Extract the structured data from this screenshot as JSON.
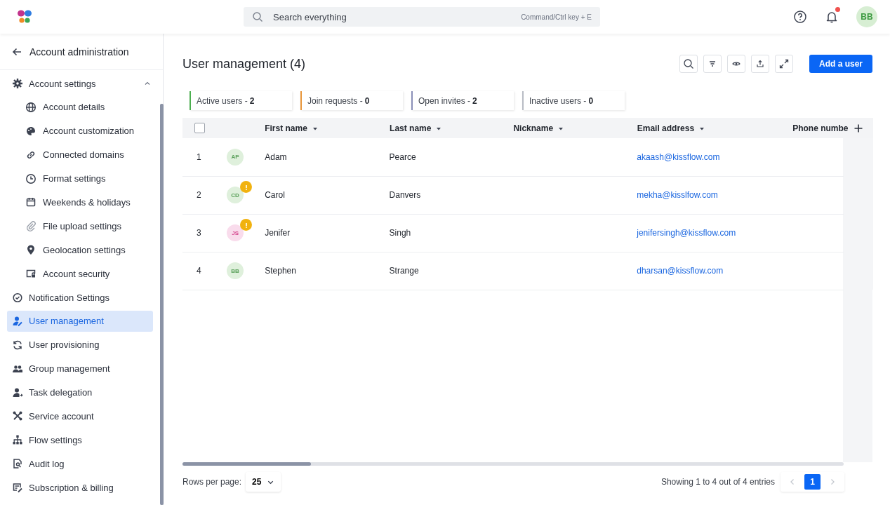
{
  "header": {
    "search": {
      "placeholder": "Search everything",
      "shortcut": "Command/Ctrl key + E"
    },
    "notifications": {
      "unread": true
    },
    "avatar": {
      "initials": "BB"
    }
  },
  "sidebar": {
    "title": "Account administration",
    "items": [
      {
        "label": "Account settings",
        "selected": false,
        "expanded": true,
        "children": [
          {
            "label": "Account details",
            "selected": false
          },
          {
            "label": "Account customization",
            "selected": false
          },
          {
            "label": "Connected domains",
            "selected": false
          },
          {
            "label": "Format settings",
            "selected": false
          },
          {
            "label": "Weekends & holidays",
            "selected": false
          },
          {
            "label": "File upload settings",
            "selected": false
          },
          {
            "label": "Geolocation settings",
            "selected": false
          },
          {
            "label": "Account security",
            "selected": false
          }
        ]
      },
      {
        "label": "Notification Settings",
        "selected": false
      },
      {
        "label": "User management",
        "selected": true
      },
      {
        "label": "User provisioning",
        "selected": false
      },
      {
        "label": "Group management",
        "selected": false
      },
      {
        "label": "Task delegation",
        "selected": false
      },
      {
        "label": "Service account",
        "selected": false
      },
      {
        "label": "Flow settings",
        "selected": false
      },
      {
        "label": "Audit log",
        "selected": false
      },
      {
        "label": "Subscription & billing",
        "selected": false
      }
    ]
  },
  "page": {
    "title": "User management (4)",
    "add_button": "Add a user"
  },
  "filters": [
    {
      "label": "Active users - **2**",
      "color": "#4caf50"
    },
    {
      "label": "Join requests - **0**",
      "color": "#e8953a"
    },
    {
      "label": "Open invites - **2**",
      "color": "#8a8fb8"
    },
    {
      "label": "Inactive users - **0**",
      "color": "#b8bcc4"
    }
  ],
  "table": {
    "select_all": {
      "checked": false
    },
    "columns": [
      {
        "label": "First name",
        "sortable": true
      },
      {
        "label": "Last name",
        "sortable": true
      },
      {
        "label": "Nickname",
        "sortable": true
      },
      {
        "label": "Email address",
        "sortable": true
      },
      {
        "label": "Phone numbe",
        "sortable": false
      }
    ],
    "rows": [
      {
        "number": "1",
        "initials": "AP",
        "color": "#dff0dc",
        "warning": false,
        "first_name": "Adam",
        "last_name": "Pearce",
        "email": "akaash@kissflow.com"
      },
      {
        "number": "2",
        "initials": "CD",
        "color": "#dff0dc",
        "warning": true,
        "first_name": "Carol",
        "last_name": "Danvers",
        "email": "mekha@kisslfow.com"
      },
      {
        "number": "3",
        "initials": "JS",
        "color": "#f9dcec",
        "warning": true,
        "first_name": "Jenifer",
        "last_name": "Singh",
        "email": "jenifersingh@kissflow.com"
      },
      {
        "number": "4",
        "initials": "BB",
        "color": "#dff0dc",
        "warning": false,
        "first_name": "Stephen",
        "last_name": "Strange",
        "email": "dharsan@kissflow.com"
      }
    ]
  },
  "footer": {
    "rows_label": "Rows per page:",
    "rows_value": "25",
    "summary": "Showing 1 to 4 out of 4 entries",
    "pages": [
      {
        "label": "1",
        "selected": true
      }
    ]
  }
}
